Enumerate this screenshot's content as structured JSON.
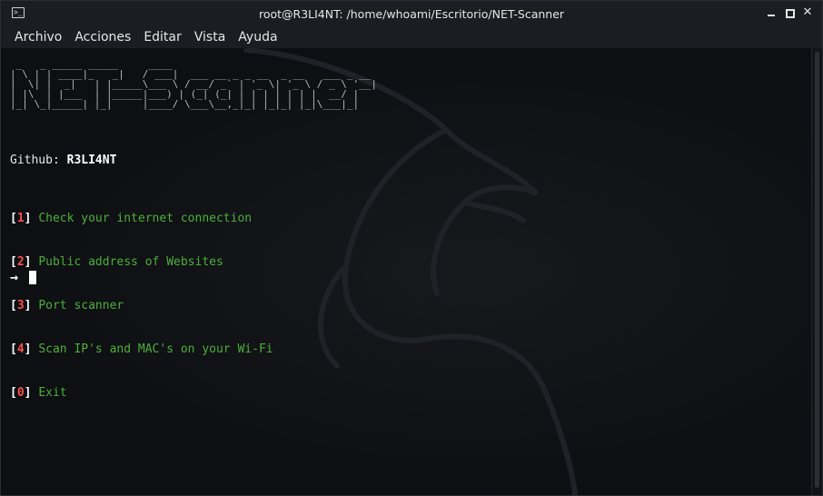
{
  "window": {
    "title": "root@R3LI4NT: /home/whoami/Escritorio/NET-Scanner"
  },
  "menubar": {
    "items": [
      "Archivo",
      "Acciones",
      "Editar",
      "Vista",
      "Ayuda"
    ]
  },
  "terminal": {
    "banner_text": "NET-Scanner",
    "github_label": "Github:",
    "github_user": "R3LI4NT",
    "options": [
      {
        "key": "1",
        "label": "Check your internet connection"
      },
      {
        "key": "2",
        "label": "Public address of Websites"
      },
      {
        "key": "3",
        "label": "Port scanner"
      },
      {
        "key": "4",
        "label": "Scan IP's and MAC's on your Wi-Fi"
      },
      {
        "key": "0",
        "label": "Exit"
      }
    ],
    "prompt_symbol": "→"
  },
  "colors": {
    "option_green": "#4caf3a",
    "number_red": "#ff4d4d",
    "background": "#0d0f12"
  },
  "icons": {
    "app": "terminal-icon",
    "minimize": "minimize-icon",
    "maximize": "maximize-icon",
    "close": "close-icon",
    "watermark": "kali-dragon-icon"
  }
}
